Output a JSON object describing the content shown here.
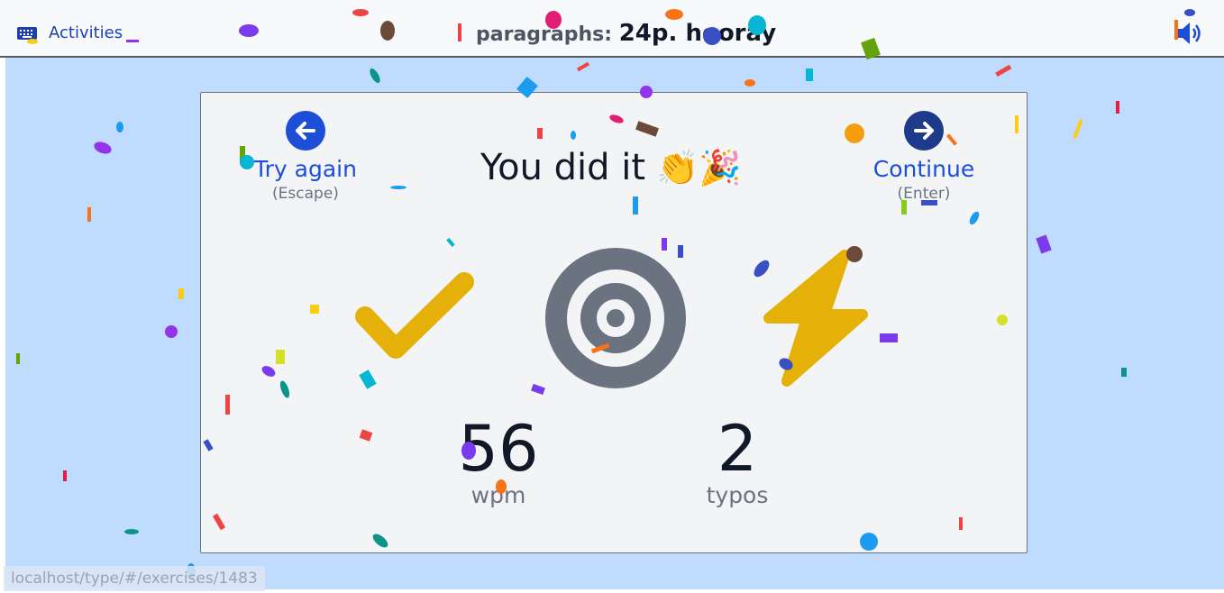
{
  "topbar": {
    "activities_label": "Activities",
    "title_label": "paragraphs:",
    "title_value": "24p. hooray",
    "icons": {
      "activities": "keyboard-icon",
      "volume": "speaker-volume-icon"
    }
  },
  "card": {
    "heading": "You did it",
    "heading_emoji": "👏🎉",
    "try_again": {
      "label": "Try again",
      "hint": "(Escape)",
      "icon": "arrow-left-icon"
    },
    "continue": {
      "label": "Continue",
      "hint": "(Enter)",
      "icon": "arrow-right-icon"
    },
    "stats": {
      "wpm": {
        "value": "56",
        "unit": "wpm"
      },
      "typos": {
        "value": "2",
        "unit": "typos"
      }
    },
    "stat_icons": [
      "checkmark-icon",
      "target-icon",
      "lightning-icon"
    ]
  },
  "statusbar": {
    "url": "localhost/type/#/exercises/1483"
  },
  "colors": {
    "accent": "#1d4ed8",
    "background": "#bfdbfe",
    "card": "#f3f4f6",
    "gold": "#e5b007",
    "target": "#6b7280"
  }
}
